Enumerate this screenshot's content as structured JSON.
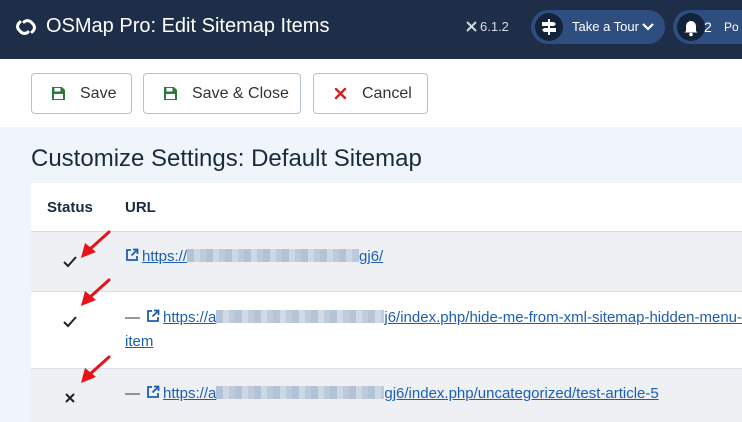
{
  "header": {
    "title": "OSMap Pro: Edit Sitemap Items",
    "version": "6.1.2",
    "tour_label": "Take a Tour",
    "notifications_count": "2",
    "notifications_more": "Po",
    "colors": {
      "bg": "#1e2e48",
      "pill": "#2f4e80"
    }
  },
  "toolbar": {
    "save_label": "Save",
    "save_close_label": "Save & Close",
    "cancel_label": "Cancel"
  },
  "page_title": "Customize Settings: Default Sitemap",
  "table": {
    "columns": [
      "Status",
      "URL"
    ],
    "rows": [
      {
        "status": "enabled",
        "prefix": "",
        "url_start": "https://",
        "url_end": "gj6/"
      },
      {
        "status": "enabled",
        "prefix": "—",
        "url_start": "https://a",
        "url_end": "j6/index.php/hide-me-from-xml-sitemap-hidden-menu-item"
      },
      {
        "status": "disabled",
        "prefix": "—",
        "url_start": "https://a",
        "url_end": "gj6/index.php/uncategorized/test-article-5"
      }
    ]
  }
}
